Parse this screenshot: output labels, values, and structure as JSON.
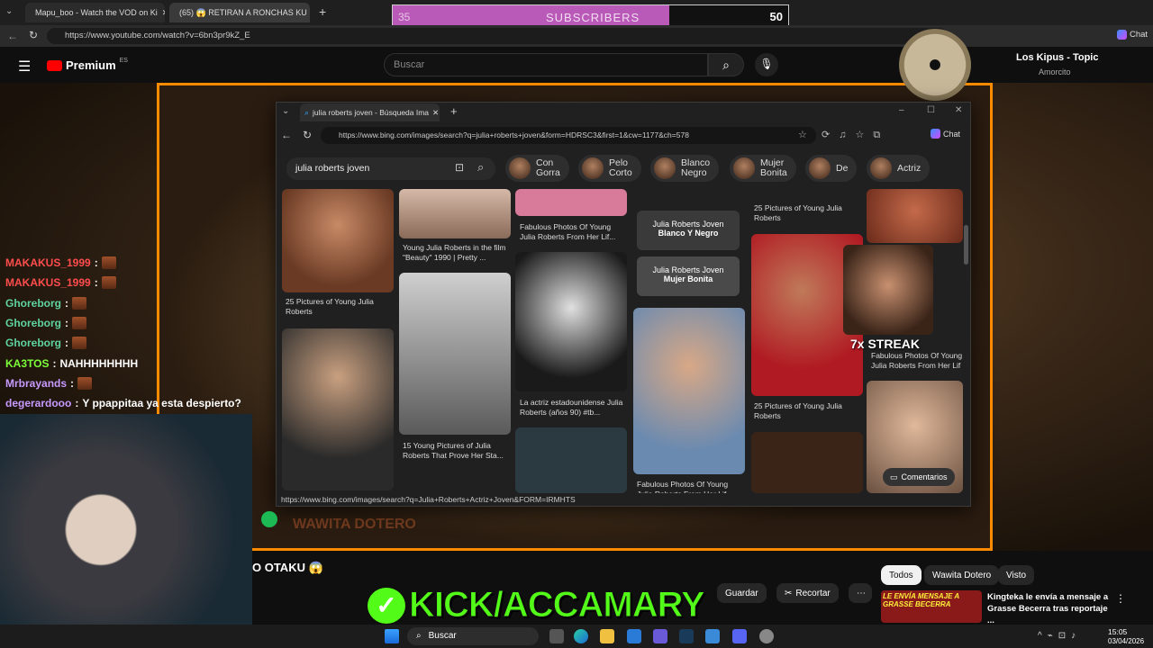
{
  "outer": {
    "tabs": [
      {
        "label": "Mapu_boo - Watch the VOD on Ki"
      },
      {
        "label": "(65) 😱 RETIRAN A RONCHAS KU"
      }
    ],
    "url": "https://www.youtube.com/watch?v=6bn3pr9kZ_E",
    "chat_label": "Chat"
  },
  "sub_goal": {
    "current": "35",
    "label": "SUBSCRIBERS",
    "target": "50",
    "progress": 0.7
  },
  "youtube": {
    "brand": "Premium",
    "region": "ES",
    "search_placeholder": "Buscar",
    "channel": "Los Kipus - Topic",
    "song": "Amorcito",
    "video_title": "O OTAKU 😱",
    "actions": {
      "save": "Guardar",
      "clip": "Recortar"
    },
    "filters": [
      "Todos",
      "Wawita Dotero",
      "Visto"
    ],
    "rec_title": "Kingteka le envía a mensaje a Grasse Becerra tras reportaje ...",
    "rec_thumb_text": "LE ENVÍA MENSAJE A GRASSE BECERRA"
  },
  "edge": {
    "tab_title": "julia roberts joven - Búsqueda Ima",
    "url": "https://www.bing.com/images/search?q=julia+roberts+joven&form=HDRSC3&first=1&cw=1177&ch=578",
    "chat_label": "Chat",
    "search_query": "julia roberts joven",
    "chips": [
      {
        "l1": "Con",
        "l2": "Gorra"
      },
      {
        "l1": "Pelo",
        "l2": "Corto"
      },
      {
        "l1": "Blanco",
        "l2": "Negro"
      },
      {
        "l1": "Mujer",
        "l2": "Bonita"
      },
      {
        "l1": "De",
        "l2": ""
      },
      {
        "l1": "Actriz",
        "l2": ""
      }
    ],
    "captions": {
      "c1": "25 Pictures of Young Julia Roberts",
      "c2": "Young Julia Roberts in the film \"Beauty\" 1990 | Pretty ...",
      "c3": "15 Young Pictures of Julia Roberts That Prove Her Sta...",
      "c4": "Fabulous Photos Of Young Julia Roberts From Her Lif...",
      "c5": "La actriz estadounidense Julia Roberts (años 90) #tb...",
      "c6": "Fabulous Photos Of Young Julia Roberts From Her Lif...",
      "c7": "25 Pictures of Young Julia Roberts",
      "c8": "25 Pictures of Young Julia Roberts",
      "c9": "Fabulous Photos Of Young Julia Roberts From Her Lif"
    },
    "related1": {
      "l1": "Julia Roberts Joven",
      "l2": "Blanco Y Negro"
    },
    "related2": {
      "l1": "Julia Roberts Joven",
      "l2": "Mujer Bonita"
    },
    "status_url": "https://www.bing.com/images/search?q=Julia+Roberts+Actriz+Joven&FORM=IRMHTS",
    "comments": "Comentarios"
  },
  "streak": "7x STREAK",
  "kick_banner": "KICK/ACCAMARY",
  "watermark": "WAWITA DOTERO",
  "chat": [
    {
      "user": "MAKAKUS_1999",
      "msg": "",
      "color": "#ff4d4d"
    },
    {
      "user": "MAKAKUS_1999",
      "msg": "",
      "color": "#ff4d4d"
    },
    {
      "user": "Ghoreborg",
      "msg": "",
      "color": "#5fd3a0"
    },
    {
      "user": "Ghoreborg",
      "msg": "",
      "color": "#5fd3a0"
    },
    {
      "user": "Ghoreborg",
      "msg": "",
      "color": "#5fd3a0"
    },
    {
      "user": "KA3TOS",
      "msg": "NAHHHHHHHH",
      "color": "#7dff3a"
    },
    {
      "user": "Mrbrayands",
      "msg": "",
      "color": "#c89aff"
    },
    {
      "user": "degerardooo",
      "msg": "Y ppappitaa ya esta despierto?",
      "color": "#c89aff"
    }
  ],
  "taskbar": {
    "search": "Buscar",
    "time": "15:05",
    "date": "03/04/2026"
  },
  "colors": {
    "accent": "#ff8c00",
    "kick_green": "#53fc18",
    "sub_bar": "#b95ab8"
  }
}
